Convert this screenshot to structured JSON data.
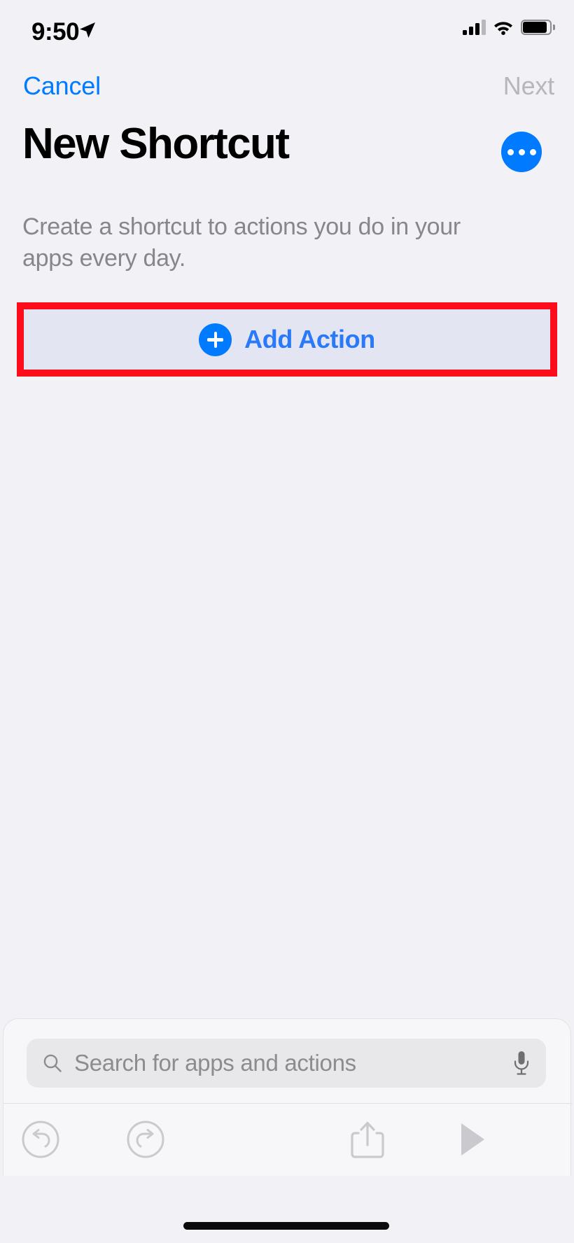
{
  "status_bar": {
    "time": "9:50",
    "location_icon": "location-arrow-icon",
    "cellular_icon": "cellular-signal-icon",
    "wifi_icon": "wifi-icon",
    "battery_icon": "battery-full-icon"
  },
  "nav": {
    "cancel_label": "Cancel",
    "next_label": "Next",
    "next_enabled": false,
    "more_icon": "ellipsis-icon"
  },
  "header": {
    "title": "New Shortcut",
    "description": "Create a shortcut to actions you do in your apps every day."
  },
  "add_action": {
    "label": "Add Action",
    "plus_icon": "plus-circle-icon",
    "highlighted": true,
    "highlight_color": "#fd0d1b",
    "button_background": "#e3e6f2",
    "label_color": "#2979f8"
  },
  "search": {
    "placeholder": "Search for apps and actions",
    "value": "",
    "search_icon": "search-icon",
    "mic_icon": "microphone-icon"
  },
  "toolbar": {
    "undo_icon": "undo-icon",
    "redo_icon": "redo-icon",
    "share_icon": "share-icon",
    "run_icon": "play-icon",
    "disabled_color": "#c9c9ce"
  },
  "colors": {
    "background": "#f2f1f6",
    "accent_blue": "#007aff",
    "disabled_gray": "#b6b6bb",
    "secondary_text": "#86868b",
    "panel_background": "#f7f7f9"
  }
}
